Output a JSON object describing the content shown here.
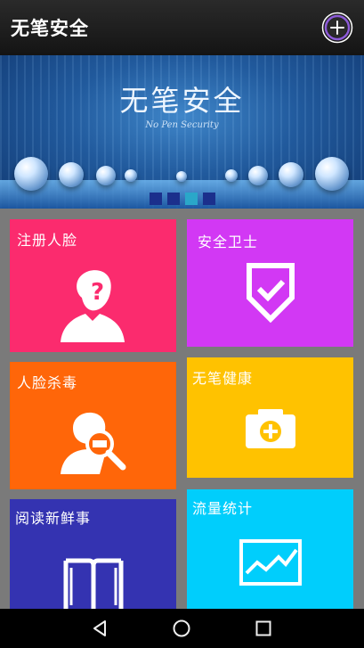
{
  "app": {
    "title": "无笔安全"
  },
  "banner": {
    "title": "无笔安全",
    "subtitle": "No Pen Security",
    "active_slide": 2,
    "slide_count": 4
  },
  "tiles": [
    {
      "label": "注册人脸",
      "color": "#fb2b6e",
      "icon": "face-register-icon"
    },
    {
      "label": "安全卫士",
      "color": "#d238f4",
      "icon": "shield-check-icon"
    },
    {
      "label": "人脸杀毒",
      "color": "#ff6609",
      "icon": "face-scan-icon"
    },
    {
      "label": "无笔健康",
      "color": "#ffc200",
      "icon": "medical-kit-icon"
    },
    {
      "label": "阅读新鲜事",
      "color": "#3433b1",
      "icon": "book-icon"
    },
    {
      "label": "流量统计",
      "color": "#00cefc",
      "icon": "chart-icon"
    }
  ],
  "navbar": {
    "buttons": [
      "back-icon",
      "home-icon",
      "recents-icon"
    ]
  }
}
